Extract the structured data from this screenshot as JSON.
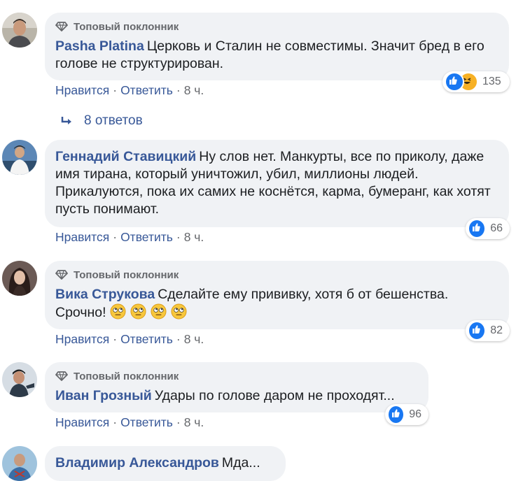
{
  "colors": {
    "accent": "#385898",
    "bubble": "#f0f2f5",
    "like": "#1877f2",
    "muted": "#65676b"
  },
  "comments": [
    {
      "badge": "Топовый поклонник",
      "author": "Pasha Platina",
      "text": "Церковь и Сталин не совместимы. Значит бред в его голове не структурирован.",
      "reactions": {
        "types": [
          "like",
          "haha"
        ],
        "count": "135"
      },
      "like_label": "Нравится",
      "reply_label": "Ответить",
      "time": "8 ч."
    },
    {
      "badge": "",
      "author": "Геннадий Ставицкий",
      "text": "Ну слов нет. Манкурты, все по приколу, даже имя тирана, который уничтожил, убил, миллионы людей. Прикалуются, пока их самих не коснётся, карма, бумеранг, как хотят пусть понимают.",
      "reactions": {
        "types": [
          "like"
        ],
        "count": "66"
      },
      "like_label": "Нравится",
      "reply_label": "Ответить",
      "time": "8 ч."
    },
    {
      "badge": "Топовый поклонник",
      "author": "Вика Струкова",
      "text": "Сделайте ему прививку, хотя б от бешенства. Срочно!",
      "emojis": [
        "face-with-rolling-eyes",
        "face-with-rolling-eyes",
        "face-with-rolling-eyes",
        "face-with-rolling-eyes"
      ],
      "reactions": {
        "types": [
          "like"
        ],
        "count": "82"
      },
      "like_label": "Нравится",
      "reply_label": "Ответить",
      "time": "8 ч."
    },
    {
      "badge": "Топовый поклонник",
      "author": "Иван Грозный",
      "text": "Удары по голове даром не проходят...",
      "reactions": {
        "types": [
          "like"
        ],
        "count": "96"
      },
      "like_label": "Нравится",
      "reply_label": "Ответить",
      "time": "8 ч."
    },
    {
      "badge": "",
      "author": "Владимир Александров",
      "text": "Мда..."
    }
  ],
  "replies_link": "8 ответов",
  "separator": "·"
}
